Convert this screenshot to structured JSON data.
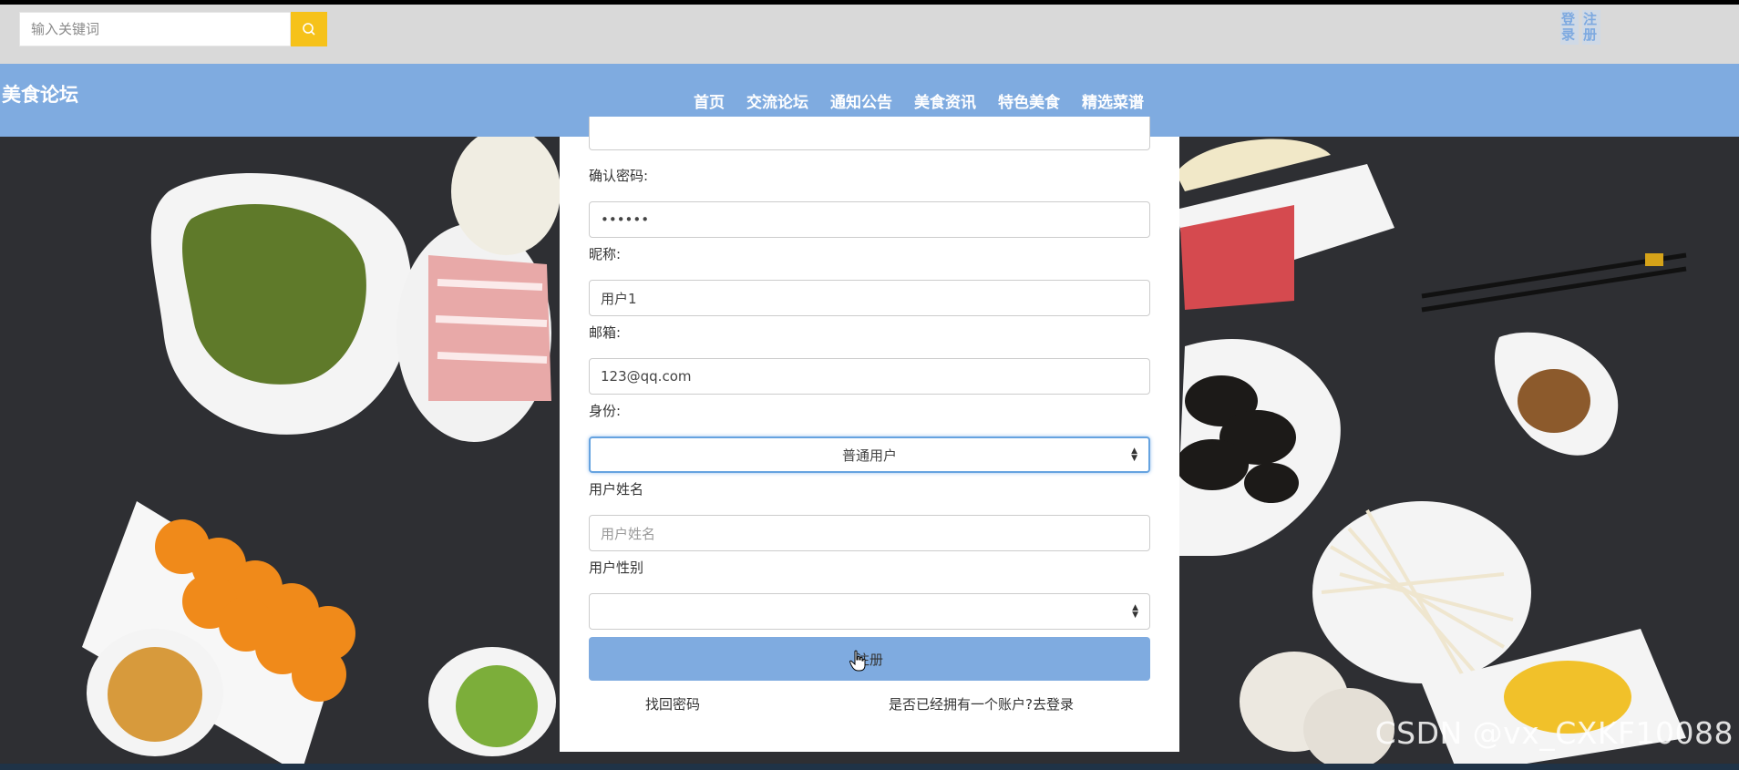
{
  "search": {
    "placeholder": "输入关键词"
  },
  "auth": {
    "login": "登录",
    "register": "注册"
  },
  "brand": "美食论坛",
  "nav": [
    "首页",
    "交流论坛",
    "通知公告",
    "美食资讯",
    "特色美食",
    "精选菜谱"
  ],
  "form": {
    "confirm_password_label": "确认密码:",
    "confirm_password_value": "••••••",
    "nickname_label": "昵称:",
    "nickname_value": "用户1",
    "email_label": "邮箱:",
    "email_value": "123@qq.com",
    "role_label": "身份:",
    "role_value": "普通用户",
    "realname_label": "用户姓名",
    "realname_placeholder": "用户姓名",
    "gender_label": "用户性别",
    "gender_value": "",
    "submit_label": "注册",
    "forgot_link": "找回密码",
    "login_link": "是否已经拥有一个账户?去登录"
  },
  "watermark": "CSDN @vx_CXKF10088",
  "colors": {
    "nav_bg": "#7fabe0",
    "search_btn": "#f6c21a",
    "top_bg": "#d9d9d9"
  }
}
